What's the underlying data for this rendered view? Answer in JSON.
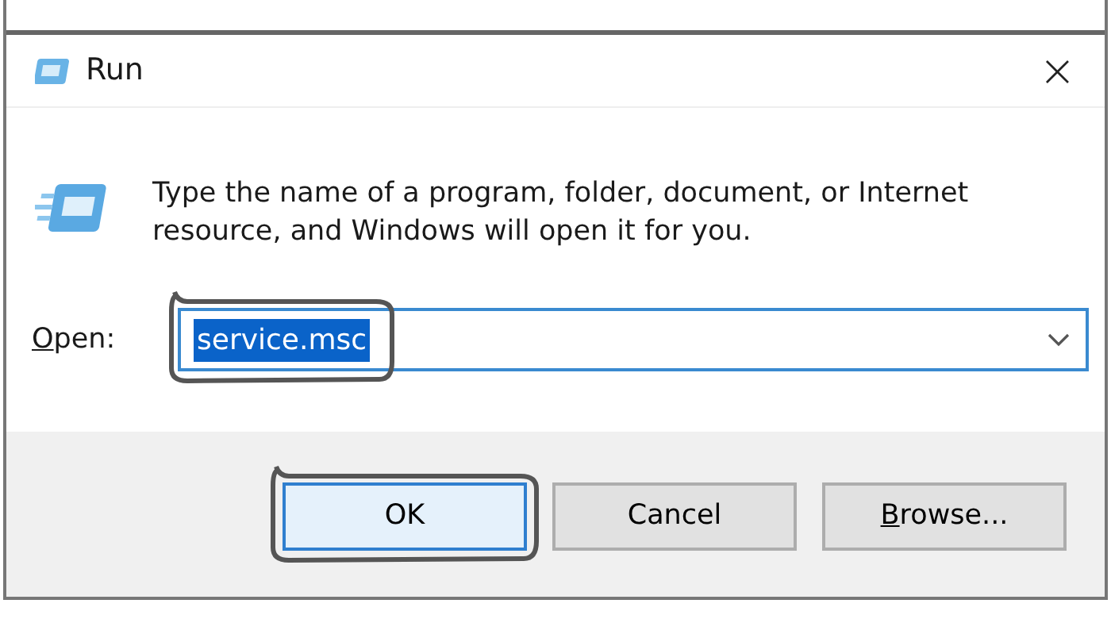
{
  "window": {
    "title": "Run",
    "close": "×"
  },
  "message": "Type the name of a program, folder, document, or Internet resource, and Windows will open it for you.",
  "open_field": {
    "label": "Open:",
    "label_access_key_underlined": true,
    "value": "service.msc",
    "value_selected": true,
    "annotated": true
  },
  "buttons": [
    {
      "label": "OK",
      "default": true,
      "access_key_underlined": false,
      "annotated": true
    },
    {
      "label": "Cancel",
      "default": false,
      "access_key_underlined": false,
      "annotated": false
    },
    {
      "label": "Browse...",
      "default": false,
      "access_key_underlined": true,
      "annotated": false
    }
  ]
}
